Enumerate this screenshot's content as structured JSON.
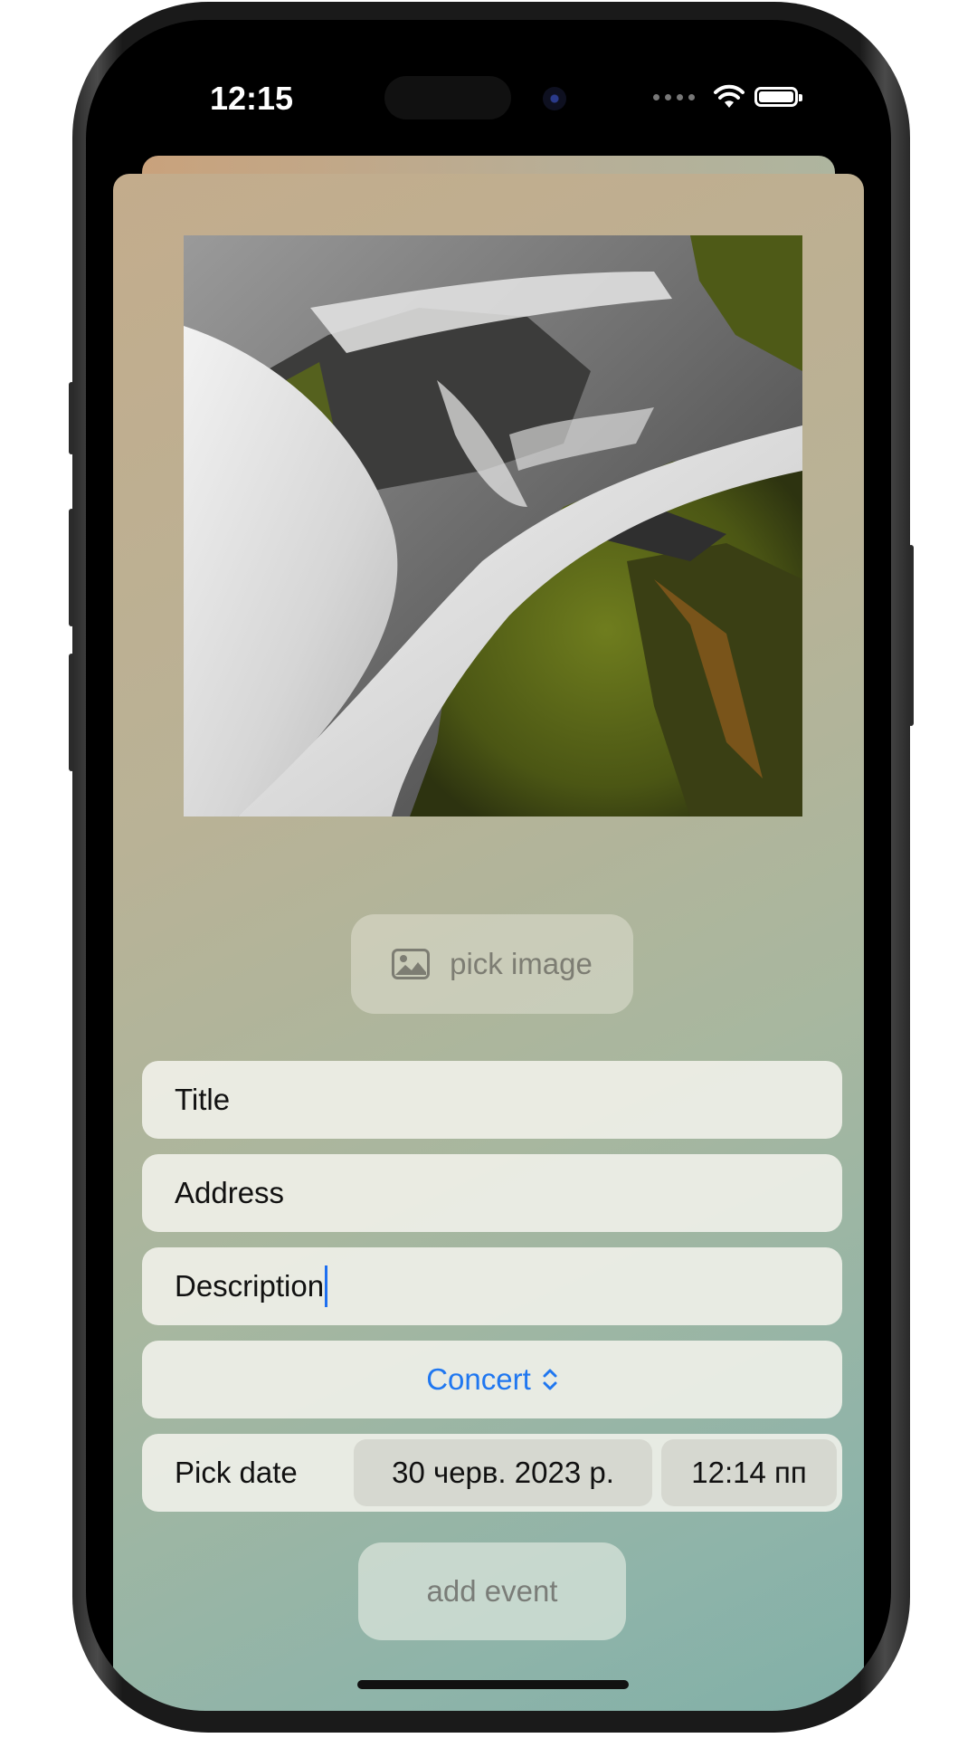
{
  "status_bar": {
    "time": "12:15"
  },
  "form": {
    "pick_image_label": "pick image",
    "title_placeholder": "Title",
    "address_placeholder": "Address",
    "description_value": "Description",
    "category_selected": "Concert",
    "date_label": "Pick date",
    "date_value": "30 черв. 2023 р.",
    "time_value": "12:14 пп",
    "add_button_label": "add event"
  },
  "icons": {
    "image": "photo-icon",
    "chevron": "chevron-up-down-icon",
    "wifi": "wifi-icon",
    "battery": "battery-icon"
  },
  "colors": {
    "accent": "#1f77f0",
    "sheet_gradient_start": "#c3ac8c",
    "sheet_gradient_end": "#7fafa8"
  }
}
